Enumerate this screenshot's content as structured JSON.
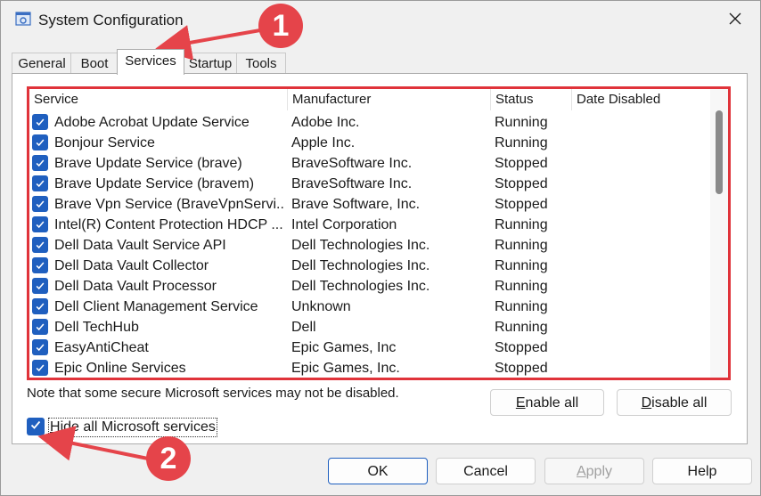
{
  "window": {
    "title": "System Configuration"
  },
  "tabs": [
    {
      "label": "General"
    },
    {
      "label": "Boot"
    },
    {
      "label": "Services"
    },
    {
      "label": "Startup"
    },
    {
      "label": "Tools"
    }
  ],
  "active_tab": "Services",
  "table": {
    "columns": [
      "Service",
      "Manufacturer",
      "Status",
      "Date Disabled"
    ],
    "rows": [
      {
        "service": "Adobe Acrobat Update Service",
        "manufacturer": "Adobe Inc.",
        "status": "Running",
        "date": ""
      },
      {
        "service": "Bonjour Service",
        "manufacturer": "Apple Inc.",
        "status": "Running",
        "date": ""
      },
      {
        "service": "Brave Update Service (brave)",
        "manufacturer": "BraveSoftware Inc.",
        "status": "Stopped",
        "date": ""
      },
      {
        "service": "Brave Update Service (bravem)",
        "manufacturer": "BraveSoftware Inc.",
        "status": "Stopped",
        "date": ""
      },
      {
        "service": "Brave Vpn Service (BraveVpnServi...",
        "manufacturer": "Brave Software, Inc.",
        "status": "Stopped",
        "date": ""
      },
      {
        "service": "Intel(R) Content Protection HDCP ...",
        "manufacturer": "Intel Corporation",
        "status": "Running",
        "date": ""
      },
      {
        "service": "Dell Data Vault Service API",
        "manufacturer": "Dell Technologies Inc.",
        "status": "Running",
        "date": ""
      },
      {
        "service": "Dell Data Vault Collector",
        "manufacturer": "Dell Technologies Inc.",
        "status": "Running",
        "date": ""
      },
      {
        "service": "Dell Data Vault Processor",
        "manufacturer": "Dell Technologies Inc.",
        "status": "Running",
        "date": ""
      },
      {
        "service": "Dell Client Management Service",
        "manufacturer": "Unknown",
        "status": "Running",
        "date": ""
      },
      {
        "service": "Dell TechHub",
        "manufacturer": "Dell",
        "status": "Running",
        "date": ""
      },
      {
        "service": "EasyAntiCheat",
        "manufacturer": "Epic Games, Inc",
        "status": "Stopped",
        "date": ""
      },
      {
        "service": "Epic Online Services",
        "manufacturer": "Epic Games, Inc.",
        "status": "Stopped",
        "date": ""
      }
    ]
  },
  "note": "Note that some secure Microsoft services may not be disabled.",
  "buttons": {
    "enable_all": "Enable all",
    "disable_all": "Disable all",
    "ok": "OK",
    "cancel": "Cancel",
    "apply": "Apply",
    "help": "Help"
  },
  "hide_ms": {
    "label": "Hide all Microsoft services",
    "checked": true
  },
  "annotations": {
    "badge1": "1",
    "badge2": "2",
    "color": "#e5444a"
  },
  "colors": {
    "accent": "#1f5fbf",
    "highlight_border": "#e0333a"
  }
}
